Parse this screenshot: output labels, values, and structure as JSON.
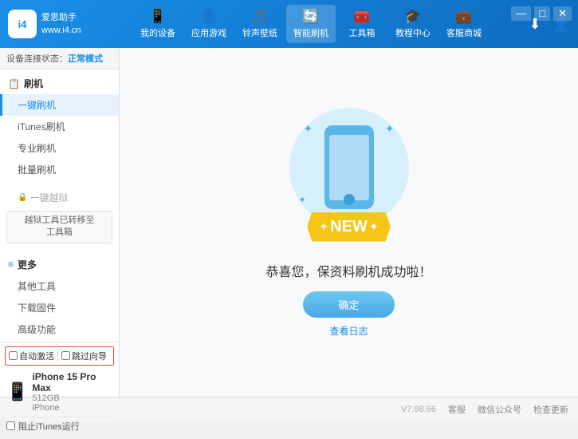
{
  "app": {
    "logo_text_line1": "爱思助手",
    "logo_text_line2": "www.i4.cn",
    "logo_abbr": "i4"
  },
  "nav": {
    "items": [
      {
        "id": "my-device",
        "label": "我的设备",
        "icon": "📱"
      },
      {
        "id": "apps-games",
        "label": "应用游戏",
        "icon": "👤"
      },
      {
        "id": "ringtone",
        "label": "铃声壁纸",
        "icon": "🎵"
      },
      {
        "id": "smart-flash",
        "label": "智能刷机",
        "icon": "🔄",
        "active": true
      },
      {
        "id": "toolbox",
        "label": "工具箱",
        "icon": "🧰"
      },
      {
        "id": "tutorials",
        "label": "教程中心",
        "icon": "🎓"
      },
      {
        "id": "service",
        "label": "客服商城",
        "icon": "💼"
      }
    ]
  },
  "sidebar": {
    "status_label": "设备连接状态：",
    "status_value": "正常模式",
    "flash_section_title": "刷机",
    "items": [
      {
        "id": "one-key-flash",
        "label": "一键刷机",
        "active": true
      },
      {
        "id": "itunes-flash",
        "label": "iTunes刷机",
        "active": false
      },
      {
        "id": "pro-flash",
        "label": "专业刷机",
        "active": false
      },
      {
        "id": "batch-flash",
        "label": "批量刷机",
        "active": false
      }
    ],
    "disabled_item": "一键越狱",
    "note_line1": "越狱工具已转移至",
    "note_line2": "工具箱",
    "more_section_title": "更多",
    "more_items": [
      {
        "id": "other-tools",
        "label": "其他工具"
      },
      {
        "id": "download-fw",
        "label": "下载固件"
      },
      {
        "id": "advanced",
        "label": "高级功能"
      }
    ],
    "auto_activate_label": "自动激活",
    "guide_label": "跳过向导",
    "device_name": "iPhone 15 Pro Max",
    "device_storage": "512GB",
    "device_type": "iPhone",
    "itunes_label": "阻止iTunes运行"
  },
  "content": {
    "new_badge": "NEW",
    "success_text": "恭喜您，保资料刷机成功啦！",
    "confirm_button": "确定",
    "log_link": "查看日志"
  },
  "footer": {
    "version": "V7.98.66",
    "items": [
      "客服",
      "微信公众号",
      "检查更新"
    ]
  }
}
